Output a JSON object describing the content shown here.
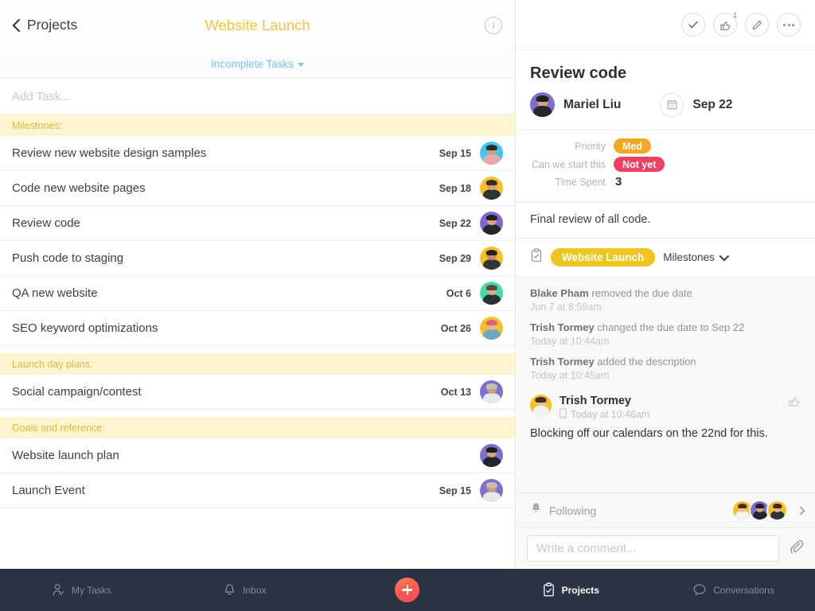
{
  "left": {
    "header": {
      "back_label": "Projects",
      "project_title": "Website Launch",
      "info_icon": "info-icon"
    },
    "filter": {
      "label": "Incomplete Tasks"
    },
    "add_task": {
      "placeholder": "Add Task...",
      "value": ""
    },
    "sections": [
      {
        "title": "Milestones:",
        "tasks": [
          {
            "name": "Review new website design samples",
            "date": "Sep 15",
            "avatar_bg": "#3fc7ee",
            "skin": "#caa07d",
            "hair": "#2e2723",
            "shirt": "#e7a9a9"
          },
          {
            "name": "Code new website pages",
            "date": "Sep 18",
            "avatar_bg": "#f7c028",
            "skin": "#d3a07a",
            "hair": "#3a2f27",
            "shirt": "#2f3239"
          },
          {
            "name": "Review code",
            "date": "Sep 22",
            "avatar_bg": "#8263d6",
            "skin": "#d6a57f",
            "hair": "#221d1a",
            "shirt": "#23262b"
          },
          {
            "name": "Push code to staging",
            "date": "Sep 29",
            "avatar_bg": "#f7c028",
            "skin": "#c08b63",
            "hair": "#2a211c",
            "shirt": "#30343b"
          },
          {
            "name": "QA new website",
            "date": "Oct 6",
            "avatar_bg": "#43dda5",
            "skin": "#dcab87",
            "hair": "#5d4a3a",
            "shirt": "#2c2f35"
          },
          {
            "name": "SEO keyword optimizations",
            "date": "Oct 26",
            "avatar_bg": "#f7c028",
            "skin": "#e2b48f",
            "hair": "#e0607e",
            "shirt": "#6fa6c4"
          }
        ]
      },
      {
        "title": "Launch day plans:",
        "tasks": [
          {
            "name": "Social campaign/contest",
            "date": "Oct 13",
            "avatar_bg": "#7b6fd0",
            "skin": "#c9a07d",
            "hair": "#cdbfae",
            "shirt": "#e8e8ea"
          }
        ]
      },
      {
        "title": "Goals and reference:",
        "tasks": [
          {
            "name": "Website launch plan",
            "date": "",
            "avatar_bg": "#7b6fd0",
            "skin": "#d6a57f",
            "hair": "#221d1a",
            "shirt": "#23262b"
          },
          {
            "name": "Launch Event",
            "date": "Sep 15",
            "avatar_bg": "#7b6fd0",
            "skin": "#c9a07d",
            "hair": "#cdbfae",
            "shirt": "#e8e8ea"
          }
        ]
      }
    ]
  },
  "detail": {
    "actions": [
      {
        "name": "complete-button",
        "icon": "check-icon",
        "badge": ""
      },
      {
        "name": "like-button",
        "icon": "thumbs-up-icon",
        "badge": "1"
      },
      {
        "name": "edit-button",
        "icon": "pencil-icon",
        "badge": ""
      },
      {
        "name": "more-button",
        "icon": "ellipsis-icon",
        "badge": ""
      }
    ],
    "title": "Review code",
    "assignee": {
      "name": "Mariel Liu",
      "avatar_bg": "#7b6fd0"
    },
    "due_date": "Sep 22",
    "calendar_icon": "calendar-icon",
    "fields": [
      {
        "label": "Priority",
        "value": "Med",
        "type": "pill",
        "color": "#f5a623"
      },
      {
        "label": "Can we start this",
        "value": "Not yet",
        "type": "pill",
        "color": "#ef4060"
      },
      {
        "label": "Time Spent",
        "value": "3",
        "type": "plain",
        "color": ""
      }
    ],
    "description": "Final review of all code.",
    "project": {
      "icon": "clipboard-icon",
      "tag": "Website Launch",
      "section": "Milestones"
    },
    "stories": [
      {
        "actor": "Blake Pham",
        "action": " removed the due date",
        "time": "Jun 7 at 8:59am"
      },
      {
        "actor": "Trish Tormey",
        "action": " changed the due date to Sep 22",
        "time": "Today at 10:44am"
      },
      {
        "actor": "Trish Tormey",
        "action": " added the description",
        "time": "Today at 10:45am"
      }
    ],
    "comment": {
      "author": "Trish Tormey",
      "device_icon": "mobile-icon",
      "time": "Today at 10:46am",
      "body": "Blocking off our calendars on the 22nd for this.",
      "like_icon": "thumbs-up-icon",
      "avatar_bg": "#f7c028"
    },
    "following": {
      "bell_icon": "bell-icon",
      "label": "Following",
      "chevron_icon": "chevron-right-icon",
      "avatars": [
        {
          "bg": "#f7c028",
          "skin": "#e6c0a0",
          "hair": "#4a2d28",
          "shirt": "#f2f2f4"
        },
        {
          "bg": "#7b6fd0",
          "skin": "#d6a57f",
          "hair": "#221d1a",
          "shirt": "#23262b"
        },
        {
          "bg": "#f7c028",
          "skin": "#e2b48f",
          "hair": "#3b2a22",
          "shirt": "#2f3239"
        }
      ]
    },
    "composer": {
      "placeholder": "Write a comment...",
      "value": "",
      "attach_icon": "paperclip-icon"
    }
  },
  "nav": {
    "items": [
      {
        "label": "My Tasks",
        "icon": "person-check-icon",
        "active": false
      },
      {
        "label": "Inbox",
        "icon": "bell-icon",
        "active": false
      },
      {
        "label": "",
        "icon": "plus-icon",
        "active": false
      },
      {
        "label": "Projects",
        "icon": "clipboard-check-icon",
        "active": true
      },
      {
        "label": "Conversations",
        "icon": "chat-bubble-icon",
        "active": false
      }
    ]
  },
  "colors": {
    "brand_yellow": "#eec83c",
    "accent_blue": "#76c6ea",
    "section_band": "#fdf5cf",
    "nav_bg": "#2b3243"
  }
}
